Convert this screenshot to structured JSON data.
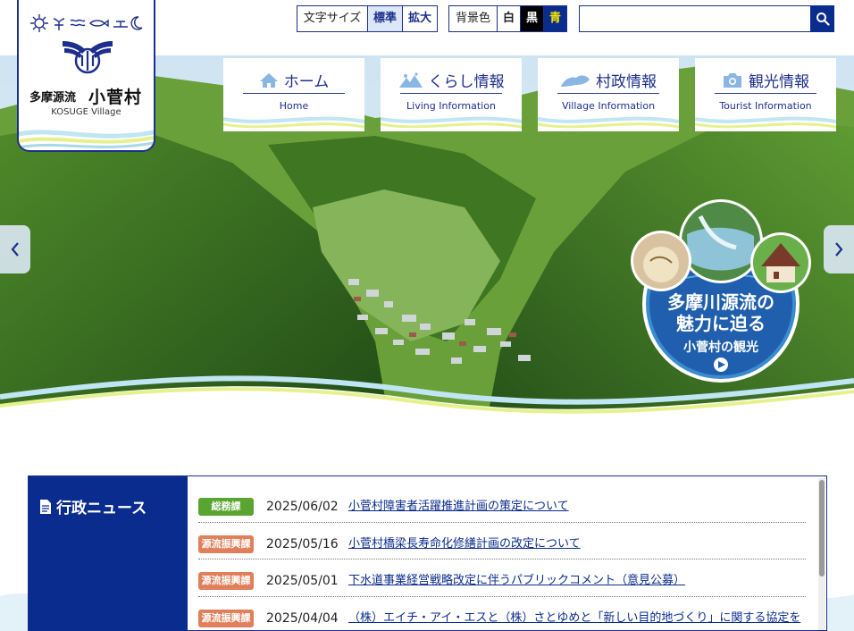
{
  "logo": {
    "name_prefix": "多摩源流",
    "name_main": "小菅村",
    "name_en": "KOSUGE Village"
  },
  "header": {
    "text_size_label": "文字サイズ",
    "text_size_standard": "標準",
    "text_size_large": "拡大",
    "bg_color_label": "背景色",
    "bg_white": "白",
    "bg_black": "黒",
    "bg_blue": "青",
    "search_placeholder": "",
    "search_value": ""
  },
  "nav": [
    {
      "jp": "ホーム",
      "en": "Home",
      "icon": "home-icon"
    },
    {
      "jp": "くらし情報",
      "en": "Living Information",
      "icon": "mountain-icon"
    },
    {
      "jp": "村政情報",
      "en": "Village Information",
      "icon": "cloud-icon"
    },
    {
      "jp": "観光情報",
      "en": "Tourist Information",
      "icon": "camera-icon"
    }
  ],
  "badge": {
    "line1": "多摩川源流の",
    "line2": "魅力に迫る",
    "line3": "小菅村の観光"
  },
  "news": {
    "title": "行政ニュース",
    "items": [
      {
        "tag": "総務課",
        "tag_color": "#5aa530",
        "date": "2025/06/02",
        "title": "小菅村障害者活躍推進計画の策定について"
      },
      {
        "tag": "源流振興課",
        "tag_color": "#e0805b",
        "date": "2025/05/16",
        "title": "小菅村橋梁長寿命化修繕計画の改定について"
      },
      {
        "tag": "源流振興課",
        "tag_color": "#e0805b",
        "date": "2025/05/01",
        "title": "下水道事業経営戦略改定に伴うパブリックコメント（意見公募）"
      },
      {
        "tag": "源流振興課",
        "tag_color": "#e0805b",
        "date": "2025/04/04",
        "title": "（株）エイチ・アイ・エスと（株）さとゆめと「新しい目的地づくり」に関する協定を"
      }
    ]
  },
  "colors": {
    "brand_navy": "#0a2c8e",
    "accent_yellow": "#f6e400"
  }
}
